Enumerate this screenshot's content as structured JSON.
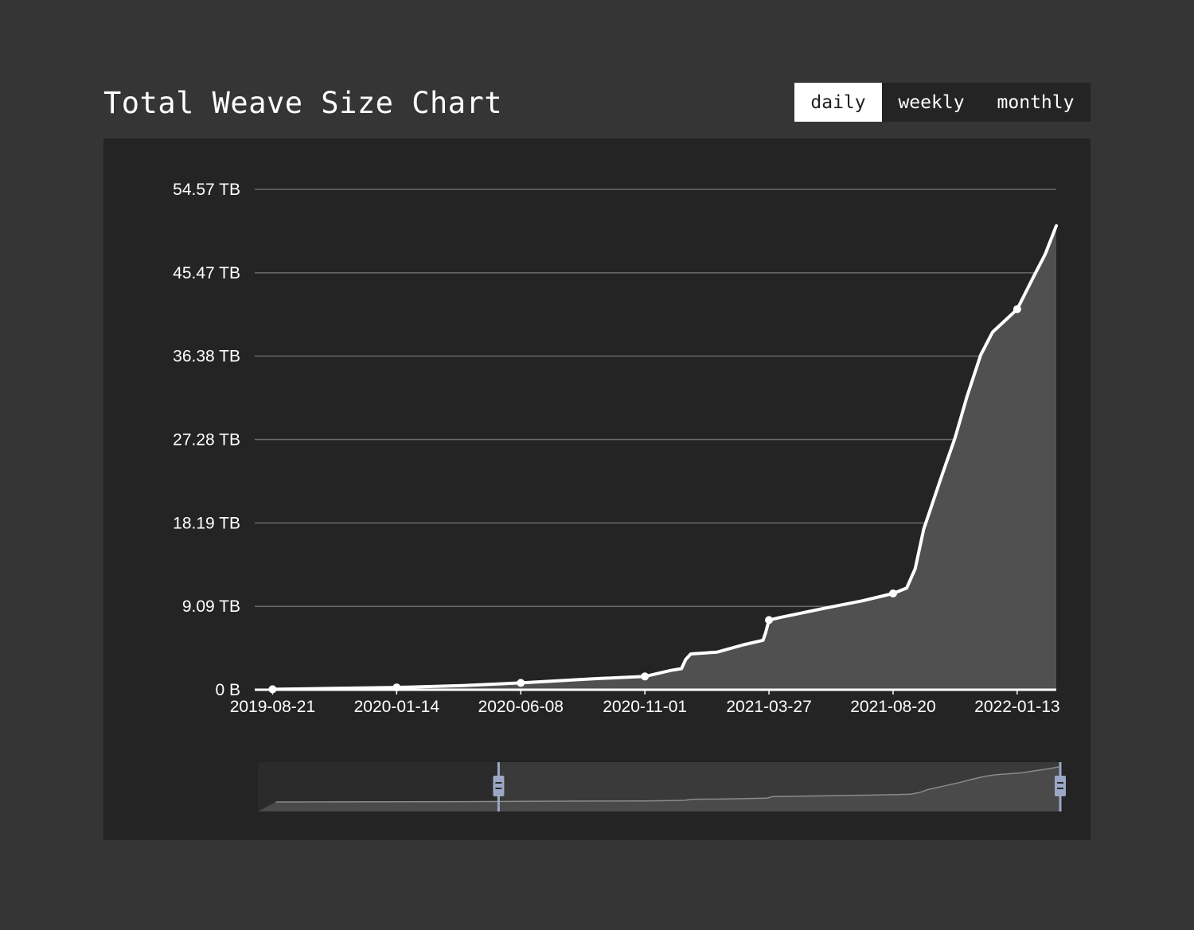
{
  "header": {
    "title": "Total Weave Size Chart"
  },
  "period_options": [
    {
      "label": "daily",
      "active": true
    },
    {
      "label": "weekly",
      "active": false
    },
    {
      "label": "monthly",
      "active": false
    }
  ],
  "colors": {
    "page_bg": "#353535",
    "panel_bg": "#242424",
    "line": "#ffffff",
    "area_fill": "#505050",
    "grid": "#6a6a6a",
    "slider_handle": "#9ba7c4"
  },
  "chart_data": {
    "type": "area",
    "title": "Total Weave Size Chart",
    "xlabel": "",
    "ylabel": "",
    "y_unit": "TB",
    "y_ticks": [
      {
        "value": 0,
        "label": "0 B"
      },
      {
        "value": 9.09,
        "label": "9.09 TB"
      },
      {
        "value": 18.19,
        "label": "18.19 TB"
      },
      {
        "value": 27.28,
        "label": "27.28 TB"
      },
      {
        "value": 36.38,
        "label": "36.38 TB"
      },
      {
        "value": 45.47,
        "label": "45.47 TB"
      },
      {
        "value": 54.57,
        "label": "54.57 TB"
      }
    ],
    "ylim": [
      0,
      54.57
    ],
    "x_ticks": [
      "2019-08-21",
      "2020-01-14",
      "2020-06-08",
      "2020-11-01",
      "2021-03-27",
      "2021-08-20",
      "2022-01-13"
    ],
    "xlim": [
      "2019-07-31",
      "2022-02-28"
    ],
    "grid": true,
    "series": [
      {
        "points": [
          {
            "x": "2019-08-21",
            "y": 0.05
          },
          {
            "x": "2019-11-01",
            "y": 0.15
          },
          {
            "x": "2020-01-14",
            "y": 0.25
          },
          {
            "x": "2020-04-01",
            "y": 0.45
          },
          {
            "x": "2020-06-08",
            "y": 0.75
          },
          {
            "x": "2020-09-01",
            "y": 1.2
          },
          {
            "x": "2020-11-01",
            "y": 1.45
          },
          {
            "x": "2020-12-01",
            "y": 2.1
          },
          {
            "x": "2020-12-14",
            "y": 2.3
          },
          {
            "x": "2020-12-19",
            "y": 3.3
          },
          {
            "x": "2020-12-25",
            "y": 3.9
          },
          {
            "x": "2021-01-25",
            "y": 4.1
          },
          {
            "x": "2021-02-25",
            "y": 4.9
          },
          {
            "x": "2021-03-20",
            "y": 5.4
          },
          {
            "x": "2021-03-23",
            "y": 6.2
          },
          {
            "x": "2021-03-27",
            "y": 7.6
          },
          {
            "x": "2021-04-10",
            "y": 7.9
          },
          {
            "x": "2021-05-01",
            "y": 8.3
          },
          {
            "x": "2021-06-01",
            "y": 8.9
          },
          {
            "x": "2021-07-15",
            "y": 9.7
          },
          {
            "x": "2021-08-20",
            "y": 10.5
          },
          {
            "x": "2021-09-05",
            "y": 11.1
          },
          {
            "x": "2021-09-15",
            "y": 13.2
          },
          {
            "x": "2021-09-25",
            "y": 17.5
          },
          {
            "x": "2021-10-15",
            "y": 23.0
          },
          {
            "x": "2021-11-01",
            "y": 27.5
          },
          {
            "x": "2021-11-15",
            "y": 32.0
          },
          {
            "x": "2021-12-01",
            "y": 36.5
          },
          {
            "x": "2021-12-15",
            "y": 39.0
          },
          {
            "x": "2022-01-13",
            "y": 41.5
          },
          {
            "x": "2022-02-01",
            "y": 45.0
          },
          {
            "x": "2022-02-15",
            "y": 47.5
          },
          {
            "x": "2022-02-28",
            "y": 50.6
          }
        ],
        "markers": [
          "2019-08-21",
          "2020-01-14",
          "2020-06-08",
          "2020-11-01",
          "2021-03-27",
          "2021-08-20",
          "2022-01-13"
        ]
      }
    ],
    "data_zoom": {
      "start_fraction": 0.3,
      "end_fraction": 1.0
    }
  }
}
